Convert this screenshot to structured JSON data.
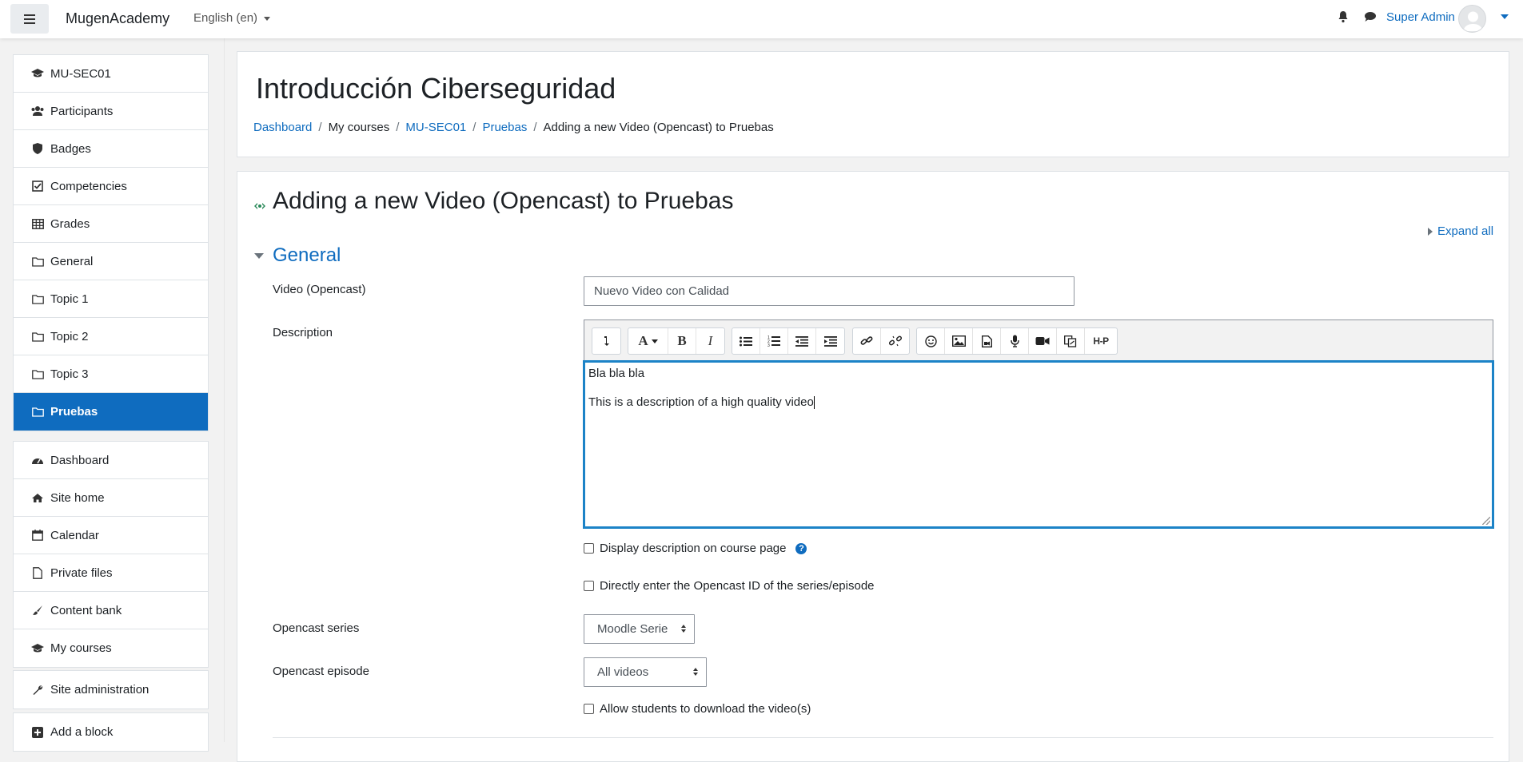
{
  "navbar": {
    "brand": "MugenAcademy",
    "language": "English (en)",
    "user_name": "Super Admin"
  },
  "drawer": {
    "course_items": [
      {
        "label": "MU-SEC01",
        "icon": "graduation-cap-icon"
      },
      {
        "label": "Participants",
        "icon": "users-icon"
      },
      {
        "label": "Badges",
        "icon": "shield-icon"
      },
      {
        "label": "Competencies",
        "icon": "check-square-icon"
      },
      {
        "label": "Grades",
        "icon": "table-icon"
      },
      {
        "label": "General",
        "icon": "folder-icon"
      },
      {
        "label": "Topic 1",
        "icon": "folder-icon"
      },
      {
        "label": "Topic 2",
        "icon": "folder-icon"
      },
      {
        "label": "Topic 3",
        "icon": "folder-icon"
      },
      {
        "label": "Pruebas",
        "icon": "folder-icon",
        "active": true
      }
    ],
    "site_items": [
      {
        "label": "Dashboard",
        "icon": "tachometer-icon"
      },
      {
        "label": "Site home",
        "icon": "home-icon"
      },
      {
        "label": "Calendar",
        "icon": "calendar-icon"
      },
      {
        "label": "Private files",
        "icon": "file-icon"
      },
      {
        "label": "Content bank",
        "icon": "paint-brush-icon"
      },
      {
        "label": "My courses",
        "icon": "graduation-cap-icon"
      }
    ],
    "admin_item": {
      "label": "Site administration",
      "icon": "wrench-icon"
    },
    "block_item": {
      "label": "Add a block",
      "icon": "plus-square-icon"
    }
  },
  "header": {
    "title": "Introducción Ciberseguridad",
    "breadcrumb": [
      "Dashboard",
      "My courses",
      "MU-SEC01",
      "Pruebas",
      "Adding a new Video (Opencast) to Pruebas"
    ]
  },
  "form": {
    "heading": "Adding a new Video (Opencast) to Pruebas",
    "expand_all": "Expand all",
    "section_general": "General",
    "video_label": "Video (Opencast)",
    "video_value": "Nuevo Video con Calidad",
    "description_label": "Description",
    "description_lines": [
      "Bla bla bla",
      "This is a description of a high quality video"
    ],
    "display_description": "Display description on course page",
    "direct_id": "Directly enter the Opencast ID of the series/episode",
    "series_label": "Opencast series",
    "series_value": "Moodle Serie",
    "episode_label": "Opencast episode",
    "episode_value": "All videos",
    "allow_download": "Allow students to download the video(s)"
  },
  "colors": {
    "accent": "#0f6cbf",
    "editor_focus": "#1c83c7"
  }
}
